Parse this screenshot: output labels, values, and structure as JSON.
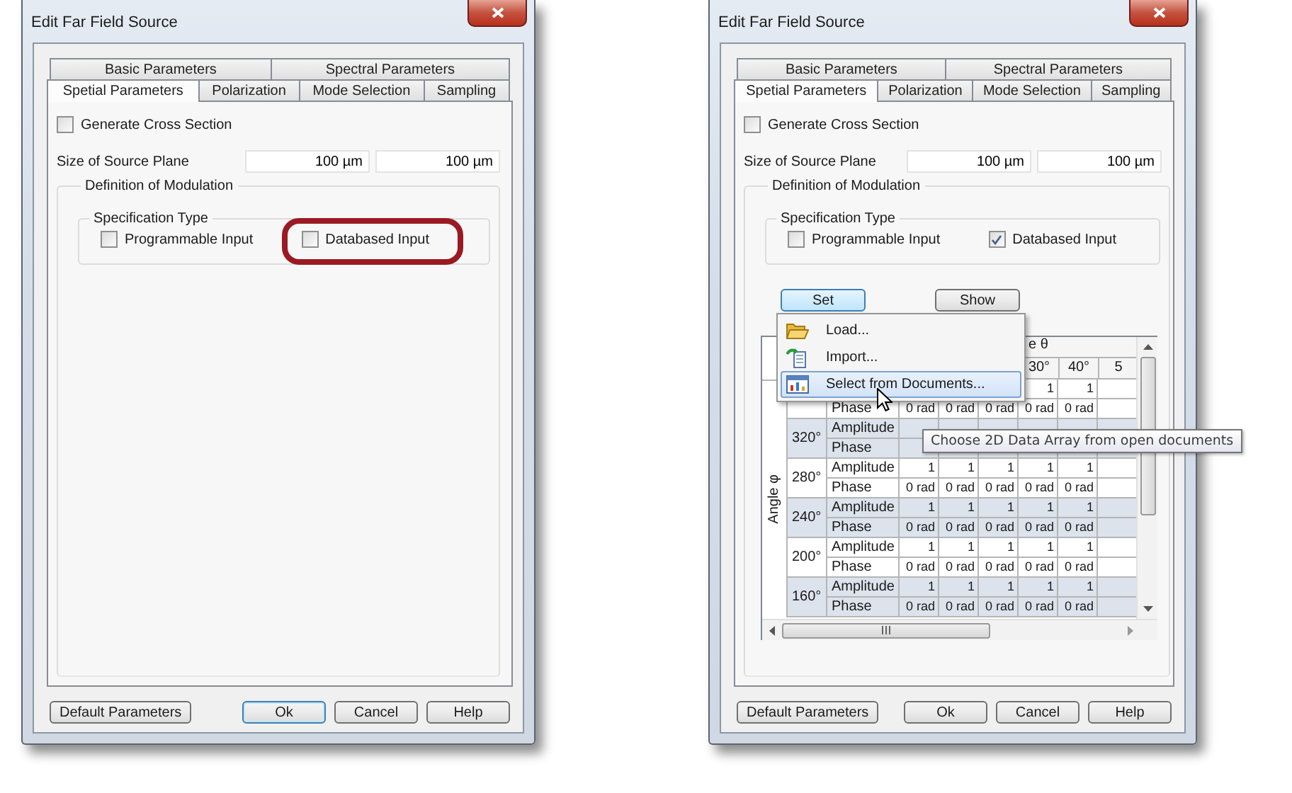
{
  "dialogs": [
    {
      "title": "Edit Far Field Source",
      "tab_rows": [
        {
          "tabs": [
            {
              "label": "Basic Parameters",
              "selected": false
            },
            {
              "label": "Spectral Parameters",
              "selected": false
            }
          ]
        },
        {
          "tabs": [
            {
              "label": "Spetial Parameters",
              "selected": true
            },
            {
              "label": "Polarization",
              "selected": false
            },
            {
              "label": "Mode Selection",
              "selected": false
            },
            {
              "label": "Sampling",
              "selected": false
            }
          ]
        }
      ],
      "generate_cross_section": {
        "label": "Generate Cross Section",
        "checked": false
      },
      "source_plane": {
        "label": "Size of Source Plane",
        "values": [
          "100 µm",
          "100 µm"
        ]
      },
      "modulation": {
        "title": "Definition of Modulation",
        "specification": {
          "title": "Specification Type",
          "options": [
            {
              "label": "Programmable Input",
              "checked": false,
              "highlighted": false
            },
            {
              "label": "Databased Input",
              "checked": false,
              "highlighted": true
            }
          ]
        }
      },
      "buttons": [
        {
          "label": "Default Parameters",
          "focused": false
        },
        {
          "label": "Ok",
          "focused": true
        },
        {
          "label": "Cancel",
          "focused": false
        },
        {
          "label": "Help",
          "focused": false
        }
      ]
    },
    {
      "title": "Edit Far Field Source",
      "tab_rows": [
        {
          "tabs": [
            {
              "label": "Basic Parameters",
              "selected": false
            },
            {
              "label": "Spectral Parameters",
              "selected": false
            }
          ]
        },
        {
          "tabs": [
            {
              "label": "Spetial Parameters",
              "selected": true
            },
            {
              "label": "Polarization",
              "selected": false
            },
            {
              "label": "Mode Selection",
              "selected": false
            },
            {
              "label": "Sampling",
              "selected": false
            }
          ]
        }
      ],
      "generate_cross_section": {
        "label": "Generate Cross Section",
        "checked": false
      },
      "source_plane": {
        "label": "Size of Source Plane",
        "values": [
          "100 µm",
          "100 µm"
        ]
      },
      "modulation": {
        "title": "Definition of Modulation",
        "specification": {
          "title": "Specification Type",
          "options": [
            {
              "label": "Programmable Input",
              "checked": false,
              "highlighted": false
            },
            {
              "label": "Databased Input",
              "checked": true,
              "highlighted": false
            }
          ]
        },
        "actions": [
          {
            "label": "Set",
            "pressed": true
          },
          {
            "label": "Show",
            "pressed": false
          }
        ],
        "data_table": {
          "axis_label": "Angle φ",
          "group_header": "e θ",
          "column_headers": [
            "30°",
            "40°",
            "5"
          ],
          "groups": [
            {
              "rows": [
                {
                  "values": [
                    "1",
                    "1"
                  ]
                },
                {
                  "type": "Phase",
                  "values": [
                    "0 rad",
                    "0 rad",
                    "0 rad",
                    "0 rad",
                    "0 rad"
                  ]
                }
              ]
            },
            {
              "angle": "320°",
              "rows": [
                {
                  "type": "Amplitude"
                },
                {
                  "type": "Phase"
                }
              ]
            },
            {
              "angle": "280°",
              "rows": [
                {
                  "type": "Amplitude",
                  "values": [
                    "1",
                    "1",
                    "1",
                    "1",
                    "1"
                  ]
                },
                {
                  "type": "Phase",
                  "values": [
                    "0 rad",
                    "0 rad",
                    "0 rad",
                    "0 rad",
                    "0 rad"
                  ]
                }
              ]
            },
            {
              "angle": "240°",
              "rows": [
                {
                  "type": "Amplitude",
                  "values": [
                    "1",
                    "1",
                    "1",
                    "1",
                    "1"
                  ]
                },
                {
                  "type": "Phase",
                  "values": [
                    "0 rad",
                    "0 rad",
                    "0 rad",
                    "0 rad",
                    "0 rad"
                  ]
                }
              ]
            },
            {
              "angle": "200°",
              "rows": [
                {
                  "type": "Amplitude",
                  "values": [
                    "1",
                    "1",
                    "1",
                    "1",
                    "1"
                  ]
                },
                {
                  "type": "Phase",
                  "values": [
                    "0 rad",
                    "0 rad",
                    "0 rad",
                    "0 rad",
                    "0 rad"
                  ]
                }
              ]
            },
            {
              "angle": "160°",
              "rows": [
                {
                  "type": "Amplitude",
                  "values": [
                    "1",
                    "1",
                    "1",
                    "1",
                    "1"
                  ]
                },
                {
                  "type": "Phase",
                  "values": [
                    "0 rad",
                    "0 rad",
                    "0 rad",
                    "0 rad",
                    "0 rad"
                  ]
                }
              ]
            }
          ]
        },
        "menu": {
          "items": [
            {
              "kind": "load",
              "label": "Load...",
              "selected": false
            },
            {
              "kind": "import",
              "label": "Import...",
              "selected": false
            },
            {
              "kind": "documents",
              "label": "Select from Documents...",
              "selected": true
            }
          ]
        },
        "tooltip": "Choose 2D Data Array from open documents"
      },
      "buttons": [
        {
          "label": "Default Parameters",
          "focused": false
        },
        {
          "label": "Ok",
          "focused": false
        },
        {
          "label": "Cancel",
          "focused": false
        },
        {
          "label": "Help",
          "focused": false
        }
      ]
    }
  ]
}
